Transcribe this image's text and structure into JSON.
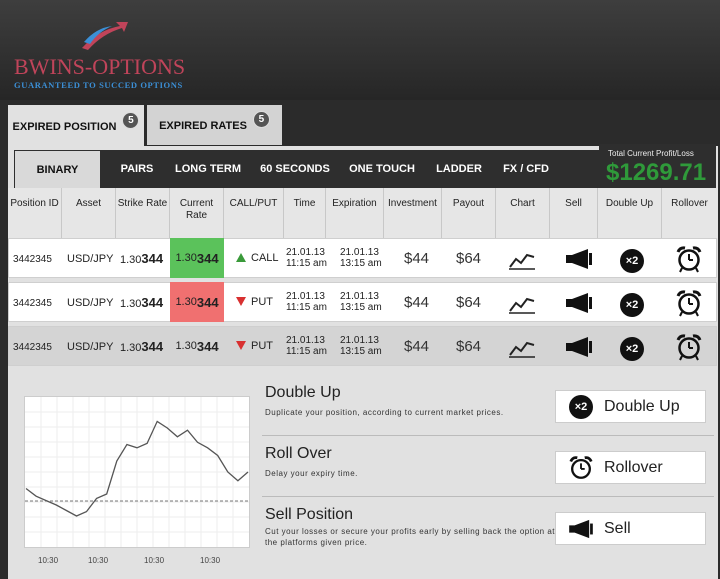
{
  "brand": {
    "name": "BWINS-OPTIONS",
    "tagline": "GUARANTEED TO SUCCED OPTIONS",
    "colors": {
      "primary": "#c0445a",
      "secondary": "#3b8fd6"
    }
  },
  "tabs": [
    {
      "label": "EXPIRED POSITION",
      "count": "5"
    },
    {
      "label": "EXPIRED RATES",
      "count": "5"
    }
  ],
  "subtabs": [
    "BINARY",
    "PAIRS",
    "LONG TERM",
    "60 SECONDS",
    "ONE TOUCH",
    "LADDER",
    "FX / CFD"
  ],
  "profit": {
    "label": "Total Current Profit/Loss",
    "value": "$1269.71",
    "color": "#2f9a3a"
  },
  "columns": [
    "Position ID",
    "Asset",
    "Strike Rate",
    "Current Rate",
    "CALL/PUT",
    "Time",
    "Expiration",
    "Investment",
    "Payout",
    "Chart",
    "Sell",
    "Double Up",
    "Rollover"
  ],
  "rows": [
    {
      "id": "3442345",
      "asset": "USD/JPY",
      "strike_pre": "1.30",
      "strike_bold": "344",
      "current_pre": "1.30",
      "current_bold": "344",
      "current_color": "#5bc25b",
      "direction": "CALL",
      "dir_icon": "triangle-up-icon",
      "time_date": "21.01.13",
      "time_clock": "11:15 am",
      "exp_date": "21.01.13",
      "exp_clock": "13:15 am",
      "investment": "$44",
      "payout": "$64",
      "double_label": "×2"
    },
    {
      "id": "3442345",
      "asset": "USD/JPY",
      "strike_pre": "1.30",
      "strike_bold": "344",
      "current_pre": "1.30",
      "current_bold": "344",
      "current_color": "#f07070",
      "direction": "PUT",
      "dir_icon": "triangle-down-icon",
      "time_date": "21.01.13",
      "time_clock": "11:15 am",
      "exp_date": "21.01.13",
      "exp_clock": "13:15 am",
      "investment": "$44",
      "payout": "$64",
      "double_label": "×2"
    },
    {
      "id": "3442345",
      "asset": "USD/JPY",
      "strike_pre": "1.30",
      "strike_bold": "344",
      "current_pre": "1.30",
      "current_bold": "344",
      "current_color": "#d4d4d4",
      "direction": "PUT",
      "dir_icon": "triangle-down-icon",
      "time_date": "21.01.13",
      "time_clock": "11:15 am",
      "exp_date": "21.01.13",
      "exp_clock": "13:15 am",
      "investment": "$44",
      "payout": "$64",
      "double_label": "×2"
    }
  ],
  "features": [
    {
      "title": "Double Up",
      "desc": "Duplicate your position, according to current market prices.",
      "button": "Double Up",
      "button_prefix": "×2"
    },
    {
      "title": "Roll Over",
      "desc": "Delay your expiry time.",
      "button": "Rollover"
    },
    {
      "title": "Sell Position",
      "desc": "Cut your losses or secure your profits early by selling back the option at the platforms given price.",
      "button": "Sell"
    }
  ],
  "mini_chart": {
    "x_ticks": [
      "10:30",
      "10:30",
      "10:30",
      "10:30"
    ],
    "values": [
      35,
      28,
      24,
      20,
      15,
      10,
      14,
      26,
      30,
      60,
      75,
      72,
      76,
      96,
      90,
      82,
      88,
      77,
      72,
      65,
      50,
      42,
      50
    ]
  }
}
